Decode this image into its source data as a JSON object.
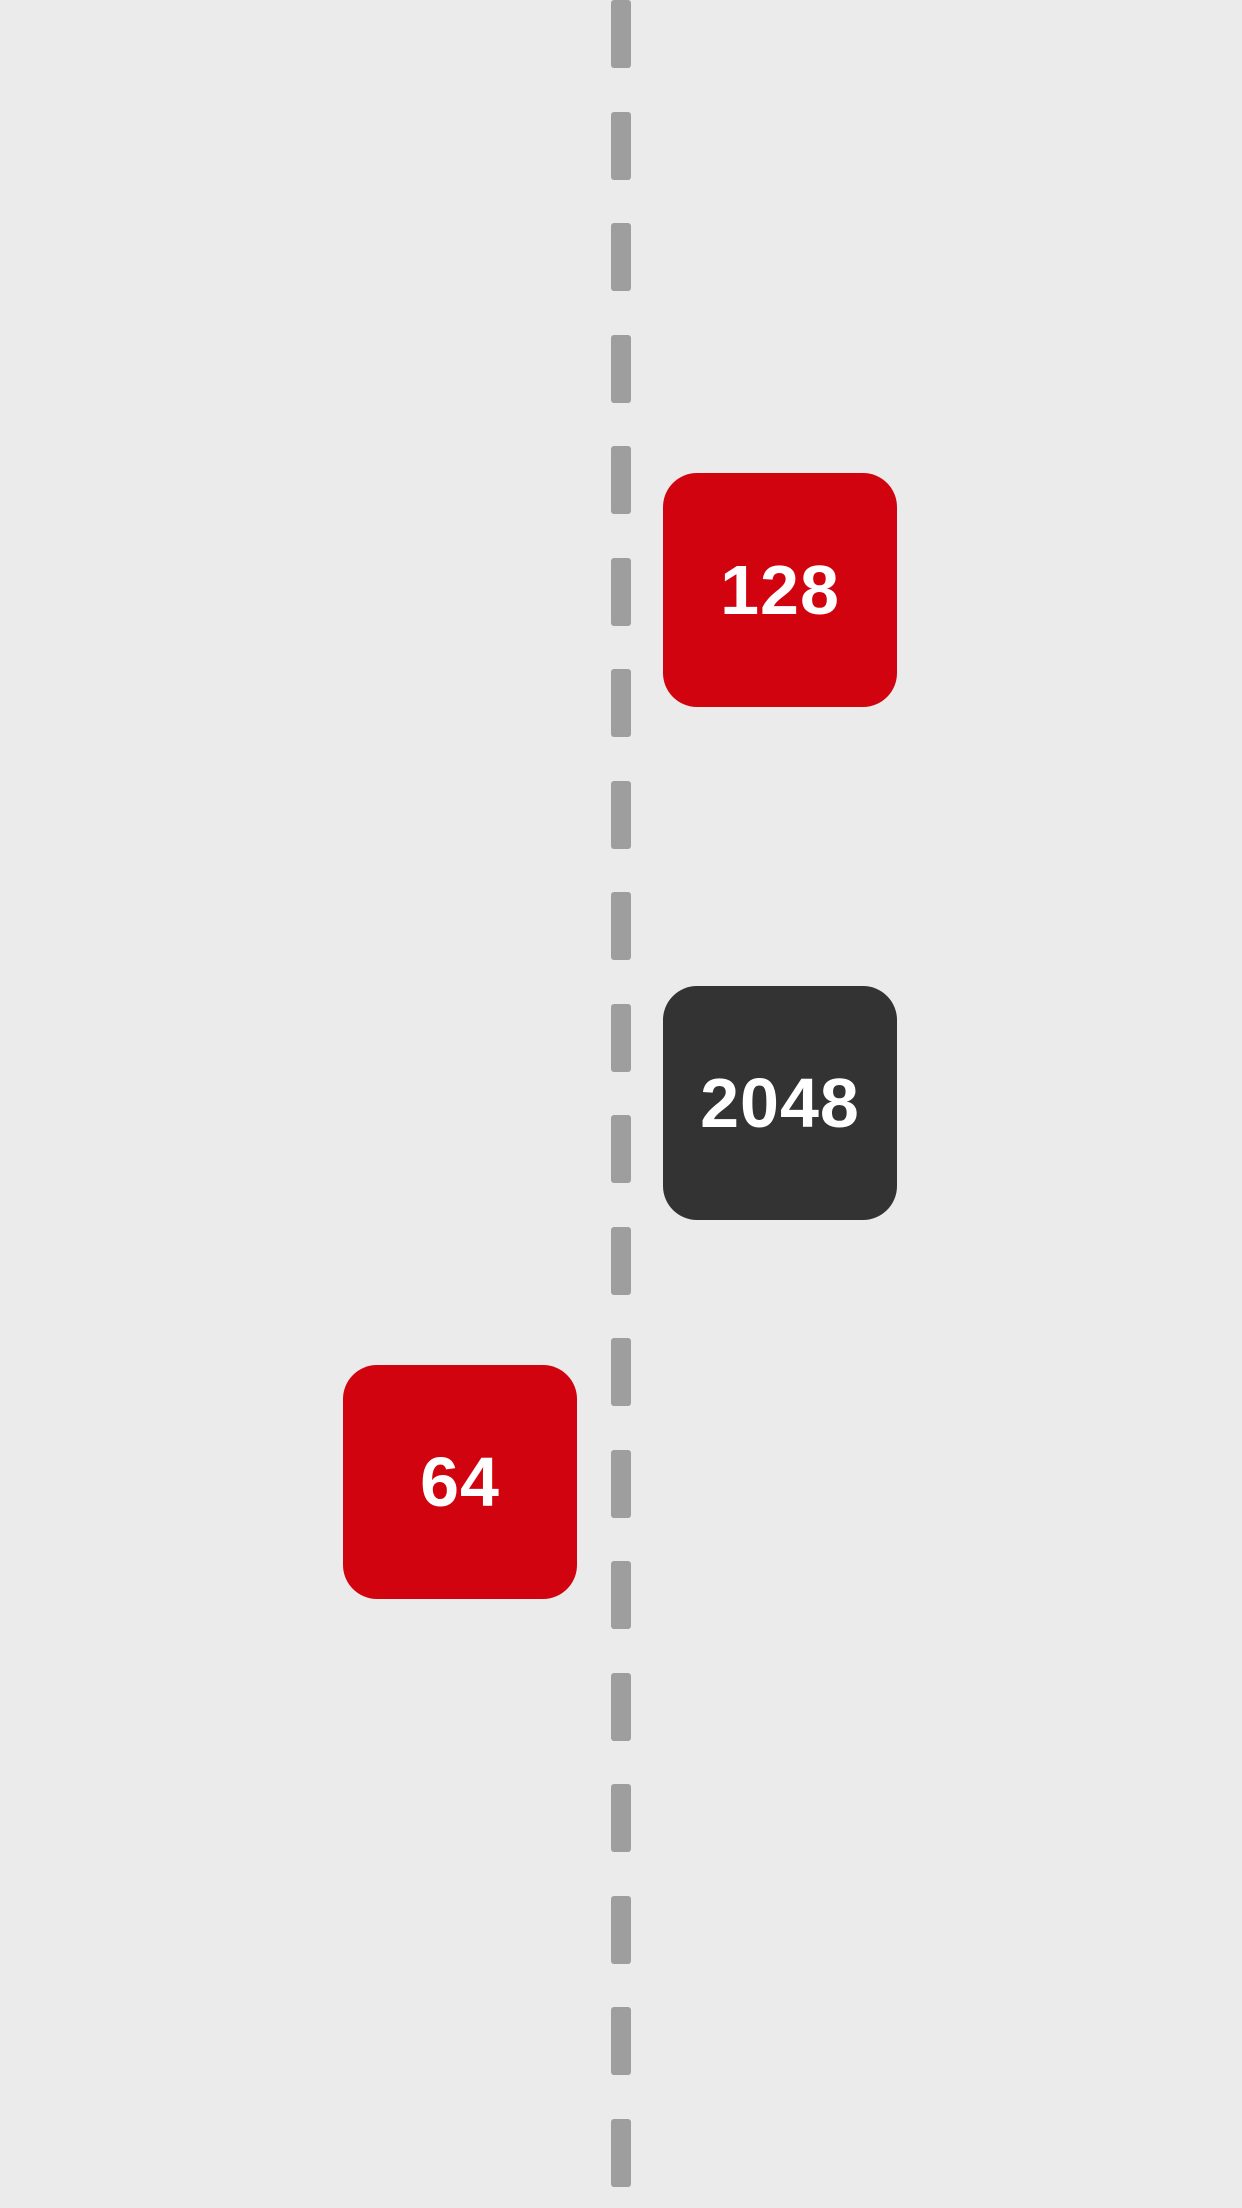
{
  "tiles": [
    {
      "value": "128",
      "color": "#d1030f"
    },
    {
      "value": "2048",
      "color": "#333333"
    },
    {
      "value": "64",
      "color": "#d1030f"
    }
  ],
  "colors": {
    "background": "#ebebec",
    "divider": "#9e9e9e",
    "tile_text": "#ffffff"
  }
}
